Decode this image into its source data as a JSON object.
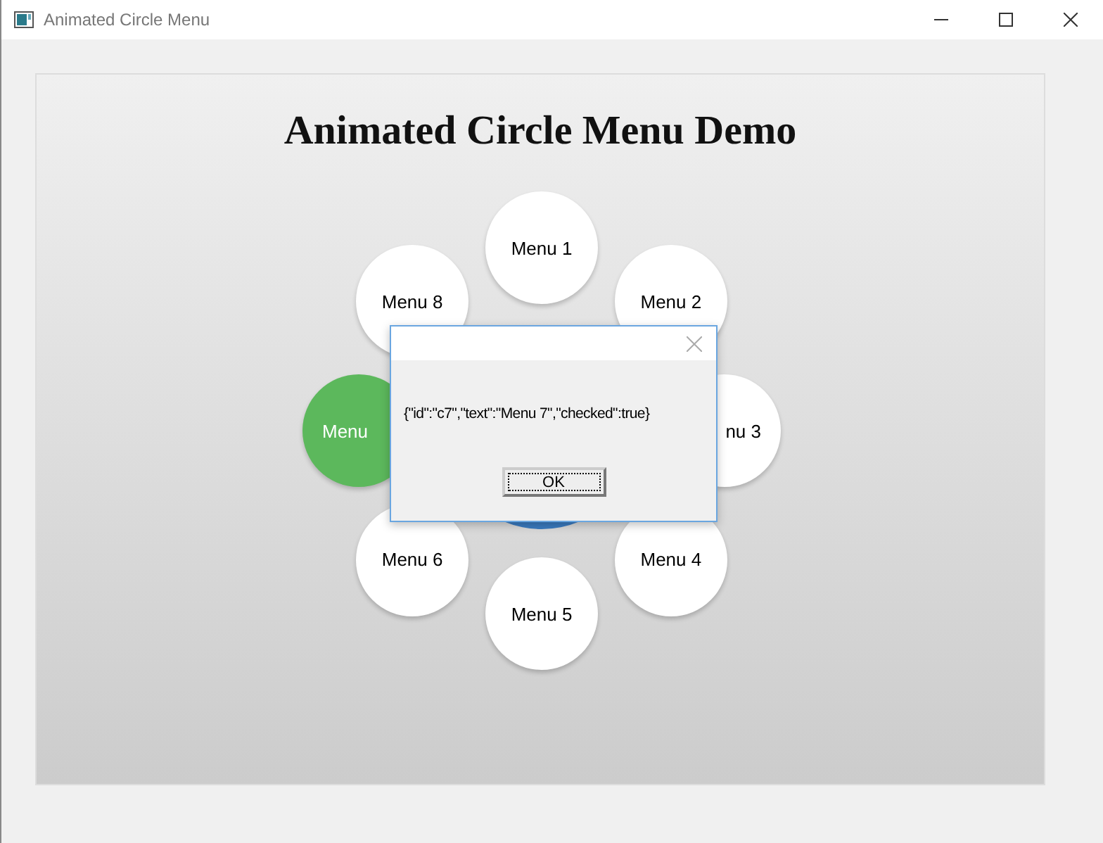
{
  "window": {
    "title": "Animated Circle Menu"
  },
  "heading": "Animated Circle Menu Demo",
  "menu_items": [
    {
      "kind": "whole",
      "text": "Menu 1",
      "checked": false
    },
    {
      "kind": "whole",
      "text": "Menu 2",
      "checked": false
    },
    {
      "kind": "tail",
      "text": "nu 3",
      "checked": false
    },
    {
      "kind": "whole",
      "text": "Menu 4",
      "checked": false
    },
    {
      "kind": "whole",
      "text": "Menu 5",
      "checked": false
    },
    {
      "kind": "whole",
      "text": "Menu 6",
      "checked": false
    },
    {
      "kind": "head",
      "text": "Menu",
      "checked": true
    },
    {
      "kind": "whole",
      "text": "Menu 8",
      "checked": false
    }
  ],
  "dialog": {
    "message": "{\"id\":\"c7\",\"text\":\"Menu 7\",\"checked\":true}",
    "button": "OK"
  }
}
